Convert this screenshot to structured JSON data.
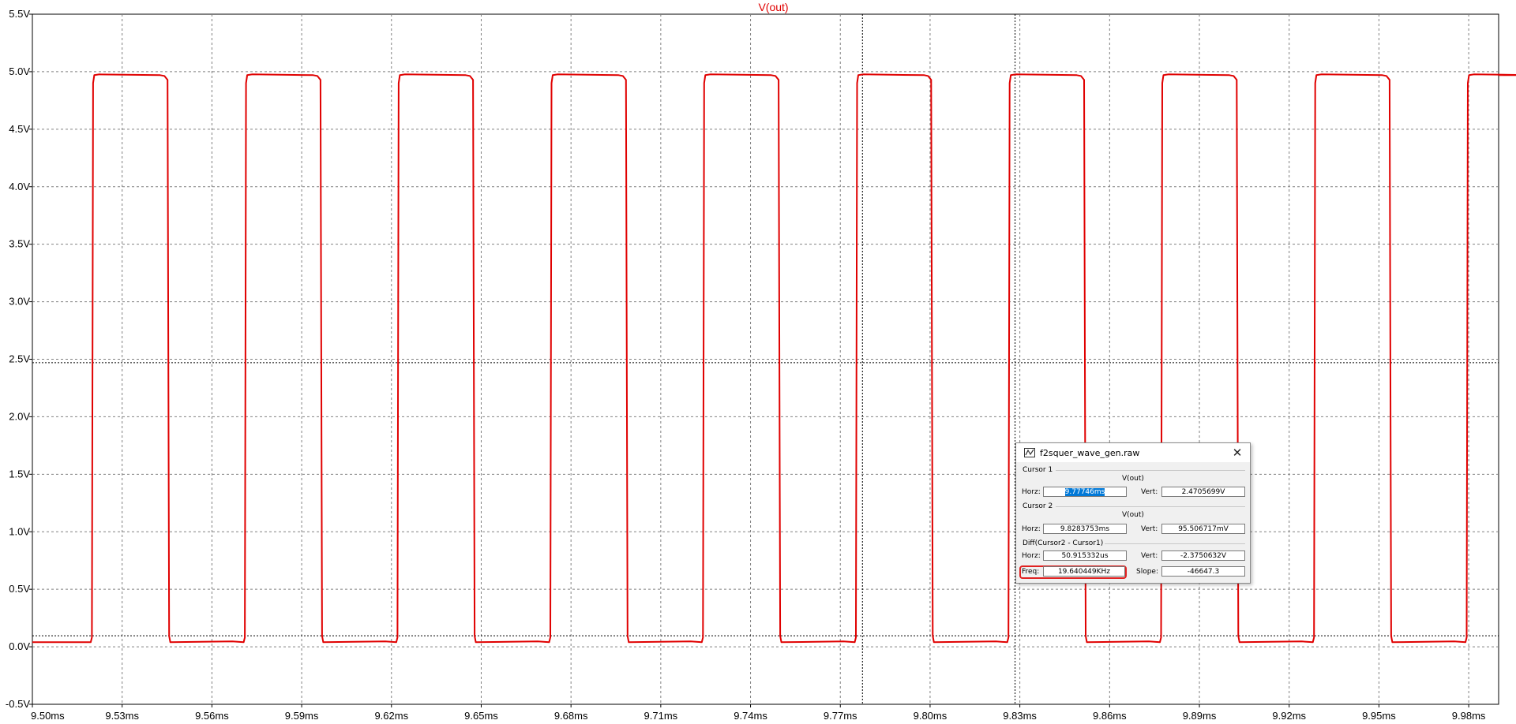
{
  "window": {
    "trace_title": "V(out)"
  },
  "chart_data": {
    "type": "line",
    "title": "V(out)",
    "xlabel": "",
    "ylabel": "",
    "xlim": [
      9.5,
      9.99
    ],
    "ylim": [
      -0.5,
      5.5
    ],
    "x_ticks": [
      "9.50ms",
      "9.53ms",
      "9.56ms",
      "9.59ms",
      "9.62ms",
      "9.65ms",
      "9.68ms",
      "9.71ms",
      "9.74ms",
      "9.77ms",
      "9.80ms",
      "9.83ms",
      "9.86ms",
      "9.89ms",
      "9.92ms",
      "9.95ms",
      "9.98ms"
    ],
    "y_ticks": [
      "-0.5V",
      "0.0V",
      "0.5V",
      "1.0V",
      "1.5V",
      "2.0V",
      "2.5V",
      "3.0V",
      "3.5V",
      "4.0V",
      "4.5V",
      "5.0V",
      "5.5V"
    ],
    "grid": true,
    "series": [
      {
        "name": "V(out)",
        "color": "#e00000",
        "low": 0.04,
        "high": 4.97,
        "rising_edges_ms": [
          9.5203,
          9.5714,
          9.6224,
          9.6735,
          9.7245,
          9.7756,
          9.8266,
          9.8776,
          9.9287,
          9.9797
        ],
        "falling_edges_ms": [
          9.5457,
          9.5968,
          9.6478,
          9.6989,
          9.7499,
          9.8009,
          9.852,
          9.903,
          9.9541
        ]
      }
    ],
    "cursors_ms": [
      9.7774,
      9.8284
    ],
    "cursor_levels_v": [
      2.47,
      0.0955
    ]
  },
  "dialog": {
    "title": "f2squer_wave_gen.raw",
    "close_glyph": "✕",
    "cursor1_label": "Cursor 1",
    "cursor1_trace": "V(out)",
    "cursor1_horz_label": "Horz:",
    "cursor1_horz_value": "9.77746ms",
    "cursor1_vert_label": "Vert:",
    "cursor1_vert_value": "2.4705699V",
    "cursor2_label": "Cursor 2",
    "cursor2_trace": "V(out)",
    "cursor2_horz_label": "Horz:",
    "cursor2_horz_value": "9.8283753ms",
    "cursor2_vert_label": "Vert:",
    "cursor2_vert_value": "95.506717mV",
    "diff_label": "Diff(Cursor2 - Cursor1)",
    "diff_horz_label": "Horz:",
    "diff_horz_value": "50.915332us",
    "diff_vert_label": "Vert:",
    "diff_vert_value": "-2.3750632V",
    "freq_label": "Freq:",
    "freq_value": "19.640449KHz",
    "slope_label": "Slope:",
    "slope_value": "-46647.3"
  }
}
